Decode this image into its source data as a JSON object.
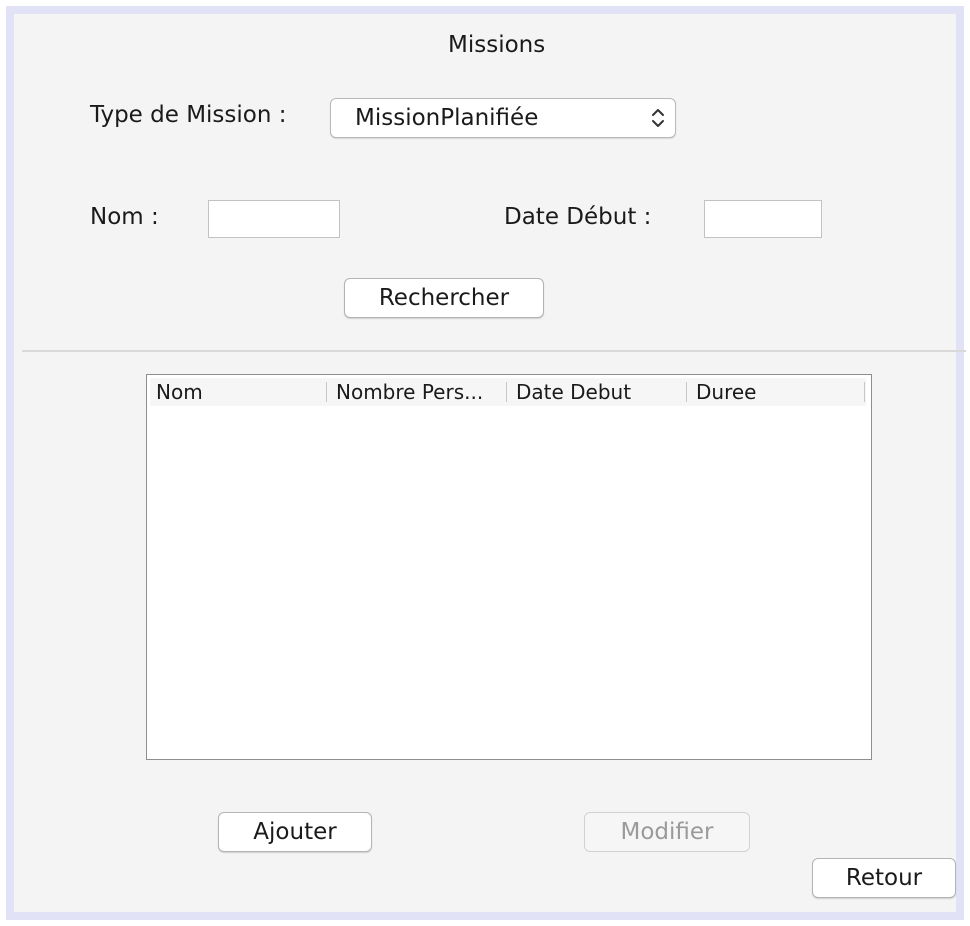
{
  "window": {
    "title": "Missions"
  },
  "filters": {
    "mission_type_label": "Type de Mission :",
    "mission_type_value": "MissionPlanifiée",
    "name_label": "Nom :",
    "name_value": "",
    "start_date_label": "Date Début :",
    "start_date_value": "",
    "search_button": "Rechercher"
  },
  "table": {
    "columns": [
      "Nom",
      "Nombre Pers...",
      "Date Debut",
      "Duree"
    ],
    "rows": []
  },
  "actions": {
    "add_button": "Ajouter",
    "edit_button": "Modifier",
    "back_button": "Retour"
  },
  "colors": {
    "window_background": "#f4f4f4",
    "frame_border": "#e2e2f7",
    "disabled_text": "#9a9a9a"
  }
}
